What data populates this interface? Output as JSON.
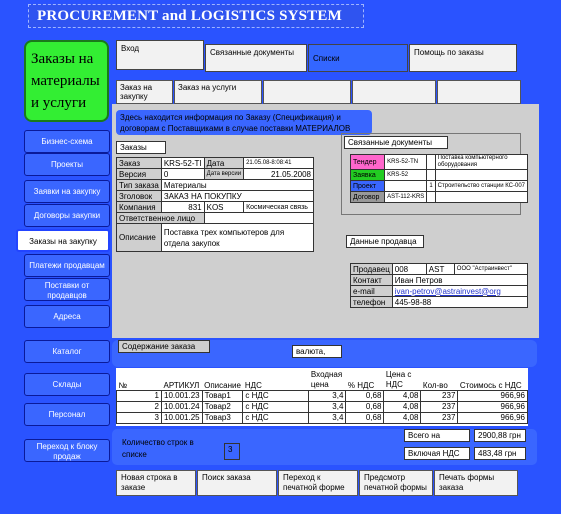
{
  "title": "PROCUREMENT and LOGISTICS SYSTEM",
  "brand": "Заказы на материалы и услуги",
  "top_buttons": [
    "Вход",
    "Связанные документы",
    "Списки",
    "Помощь по заказы"
  ],
  "sidebar": [
    "Бизнес-схема",
    "Проекты",
    "Заявки на закупку",
    "Договоры закупки",
    "Заказы на закупку",
    "Платежи продавцам",
    "Поставки от продавцов",
    "Адреса",
    "Каталог",
    "Склады",
    "Персонал",
    "Переход к блоку продаж"
  ],
  "tabs": [
    "Заказ на закупку",
    "Заказ на услуги"
  ],
  "info_text": "Здесь находится информация по Заказу (Спецификация) и договорам с Поставщиками в случае поставки МАТЕРИАЛОВ",
  "orders": {
    "header": "Заказы",
    "order_label": "Заказ",
    "order_value": "KRS-52-TI",
    "date_label": "Дата",
    "date_value": "21.05.08-8:08:41",
    "version_label": "Версия",
    "version_value": "0",
    "version_date_label": "Дата версии",
    "version_date_value": "21.05.2008",
    "type_label": "Тип заказа",
    "type_value": "Материалы",
    "heading_label": "Зголовок",
    "heading_value": "ЗАКАЗ НА ПОКУПКУ",
    "company_label": "Компания",
    "company_code": "831",
    "company_short": "KOS",
    "company_name": "Космическая связь",
    "responsible_label": "Ответственное лицо",
    "responsible_value": "",
    "desc_label": "Описание",
    "desc_value": "Поставка трех компьютеров для отдела закупок"
  },
  "related": {
    "header": "Связанные документы",
    "rows": [
      {
        "label": "Тендер",
        "code": "KRS-52-TN",
        "n": "",
        "text": "Поставка компьютерного оборудования",
        "color": "#ff66cc"
      },
      {
        "label": "Заявка",
        "code": "KRS-52",
        "n": "",
        "text": "",
        "color": "#22cc22"
      },
      {
        "label": "Проект",
        "code": "",
        "n": "1",
        "text": "Строительство станции КС-007",
        "color": "#3a66ff"
      },
      {
        "label": "Договор",
        "code": "AST-112-KRS",
        "n": "",
        "text": "",
        "color": "#999999"
      }
    ]
  },
  "seller": {
    "header": "Данные продавца",
    "seller_label": "Продавец",
    "seller_code": "008",
    "seller_short": "AST",
    "seller_name": "ООО \"Астраинвест\"",
    "contact_label": "Контакт",
    "contact_value": "Иван Петров",
    "email_label": "e-mail",
    "email_value": "ivan-petrov@astrainvest@org",
    "phone_label": "телефон",
    "phone_value": "445-98-88"
  },
  "content": {
    "header": "Содержание заказа",
    "currency_label": "валюта,",
    "columns": [
      "№",
      "АРТИКУЛ",
      "Описание",
      "НДС",
      "Входная цена",
      "% НДС",
      "Цена с НДС",
      "Кол-во",
      "Стоимось с НДС"
    ],
    "rows": [
      [
        "1",
        "10.001.23",
        "Товар1",
        "с НДС",
        "3,4",
        "0,68",
        "4,08",
        "237",
        "966,96"
      ],
      [
        "2",
        "10.001.24",
        "Товар2",
        "с НДС",
        "3,4",
        "0,68",
        "4,08",
        "237",
        "966,96"
      ],
      [
        "3",
        "10.001.25",
        "Товар3",
        "с НДС",
        "3,4",
        "0,68",
        "4,08",
        "237",
        "966,96"
      ]
    ],
    "rows_count_label": "Количество строк в списке",
    "rows_count": "3",
    "total_label": "Всего на",
    "total_value": "2900,88 грн",
    "vat_label": "Включая НДС",
    "vat_value": "483,48 грн"
  },
  "bottom_buttons": [
    "Новая строка в заказе",
    "Поиск заказа",
    "Переход к печатной форме",
    "Предсмотр печатной формы",
    "Печать формы заказа"
  ]
}
